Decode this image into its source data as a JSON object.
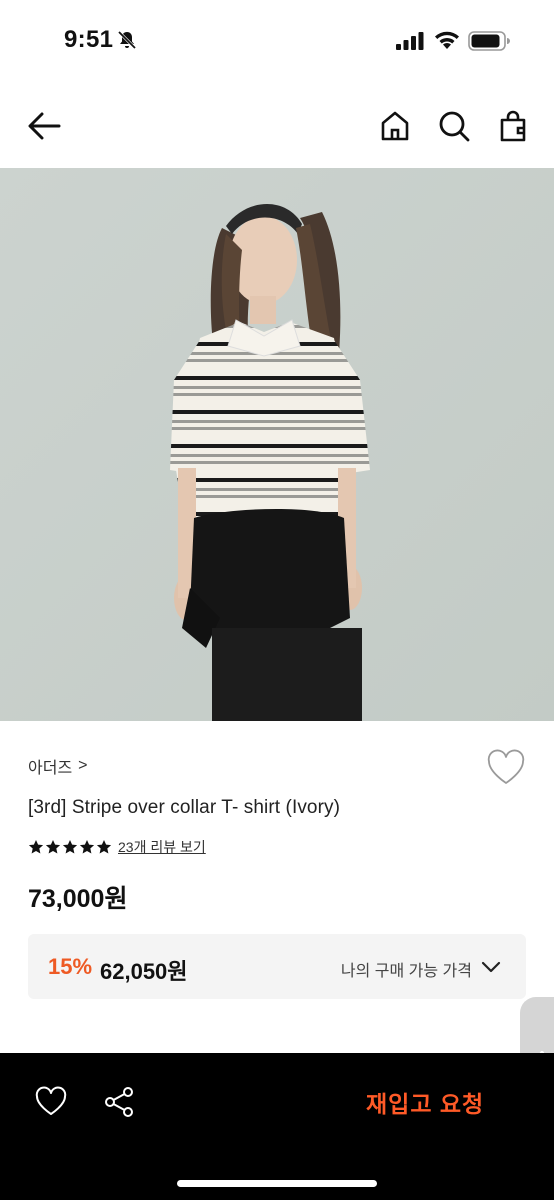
{
  "status_bar": {
    "time": "9:51",
    "icons": [
      "bell-slash-icon",
      "signal-icon",
      "wifi-icon",
      "battery-icon"
    ]
  },
  "nav": {
    "icons": [
      "back-arrow-icon",
      "home-icon",
      "search-icon",
      "shopping-bag-icon"
    ]
  },
  "product": {
    "image_description": "photo-icon",
    "brand": "아더즈",
    "brand_chevron": ">",
    "title": "[3rd] Stripe over collar T- shirt (Ivory)",
    "rating_stars": 5,
    "review_link": "23개 리뷰 보기",
    "price_original": "73,000원",
    "discount": {
      "rate": "15%",
      "price": "62,050원",
      "my_price_label": "나의 구매 가능 가격"
    }
  },
  "bottom_bar": {
    "restock_label": "재입고 요청"
  },
  "colors": {
    "accent": "#ee5a24",
    "bottom_bar_bg": "#000000",
    "price_box_bg": "#f4f4f4",
    "restock_text": "#ff5a27"
  }
}
